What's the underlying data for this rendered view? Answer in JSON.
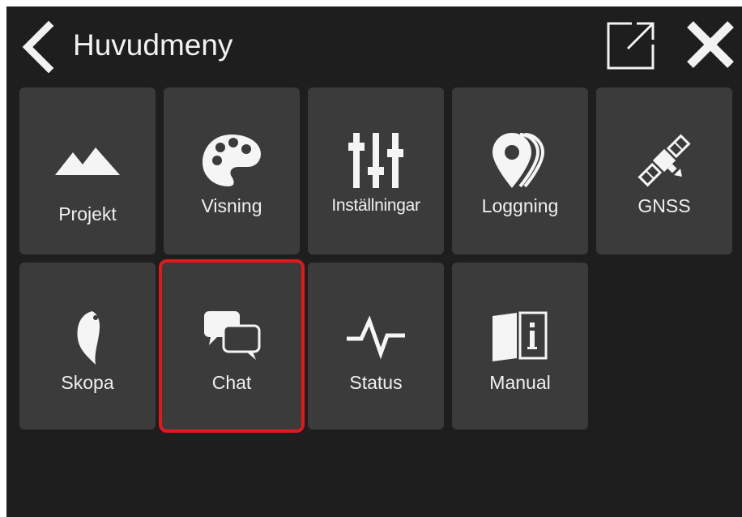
{
  "header": {
    "title": "Huvudmeny",
    "back_icon": "chevron-left-icon",
    "popout_icon": "external-window-icon",
    "close_icon": "close-icon"
  },
  "tiles": [
    {
      "label": "Projekt",
      "icon": "mountains-icon"
    },
    {
      "label": "Visning",
      "icon": "palette-icon"
    },
    {
      "label": "Inställningar",
      "icon": "sliders-icon"
    },
    {
      "label": "Loggning",
      "icon": "stacked-pins-icon"
    },
    {
      "label": "GNSS",
      "icon": "satellite-icon"
    },
    {
      "label": "Skopa",
      "icon": "bucket-icon"
    },
    {
      "label": "Chat",
      "icon": "chat-bubbles-icon",
      "selected": true
    },
    {
      "label": "Status",
      "icon": "pulse-icon"
    },
    {
      "label": "Manual",
      "icon": "manual-book-icon"
    }
  ],
  "colors": {
    "background": "#1e1e1e",
    "tile": "#3b3b3b",
    "text": "#f0f0f0",
    "selection": "#e01a1a"
  }
}
